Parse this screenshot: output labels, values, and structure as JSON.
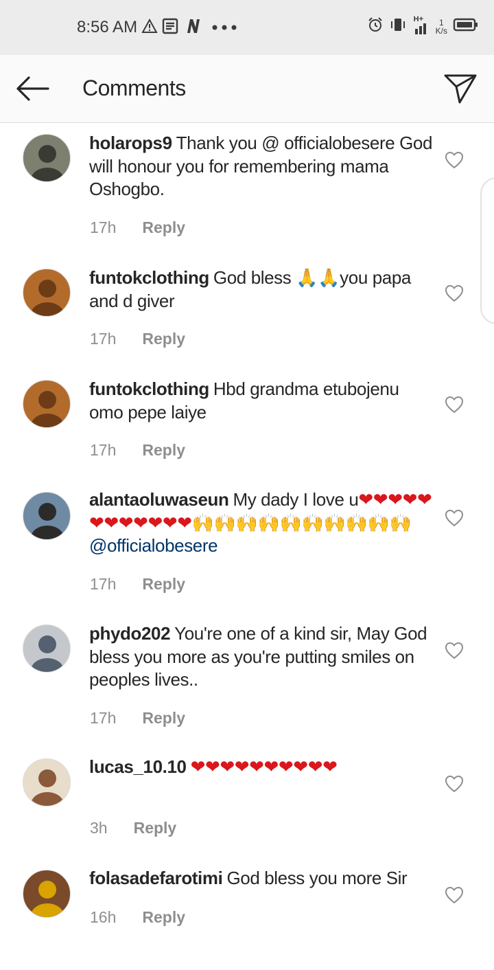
{
  "status_bar": {
    "time": "8:56 AM",
    "left_icons": [
      "warning-icon",
      "news-icon",
      "n-app-icon",
      "more-dots-icon"
    ],
    "right_icons": [
      "alarm-icon",
      "vibrate-icon",
      "signal-h-plus-icon",
      "signal-bars-icon",
      "network-speed-icon",
      "battery-icon"
    ],
    "net_speed_value": "1",
    "net_speed_unit": "K/s",
    "network_type": "H+"
  },
  "header": {
    "title": "Comments",
    "back_icon": "arrow-left-icon",
    "share_icon": "paper-plane-icon"
  },
  "comments": [
    {
      "username": "holarops9",
      "parts": [
        {
          "t": "Thank you @ officialobesere God will honour you for remembering mama Oshogbo."
        }
      ],
      "time": "17h",
      "reply": "Reply",
      "avatar": {
        "bg": "#7d7f6f",
        "fg": "#3b3a33"
      }
    },
    {
      "username": "funtokclothing",
      "parts": [
        {
          "t": "God bless "
        },
        {
          "t": "🙏🙏",
          "cls": "emoji-hands"
        },
        {
          "t": "you papa and d giver"
        }
      ],
      "time": "17h",
      "reply": "Reply",
      "avatar": {
        "bg": "#b36b2c",
        "fg": "#6d3c17"
      }
    },
    {
      "username": "funtokclothing",
      "parts": [
        {
          "t": "Hbd grandma etubojenu omo pepe laiye"
        }
      ],
      "time": "17h",
      "reply": "Reply",
      "avatar": {
        "bg": "#b36b2c",
        "fg": "#6d3c17"
      }
    },
    {
      "username": "alantaoluwaseun",
      "parts": [
        {
          "t": "My dady I love u"
        },
        {
          "t": "❤❤❤❤❤❤❤❤❤❤❤❤",
          "cls": "emoji-heart"
        },
        {
          "t": "🙌🙌🙌🙌🙌🙌🙌🙌🙌🙌",
          "cls": "emoji-hands"
        },
        {
          "t": " "
        },
        {
          "t": "@officialobesere",
          "cls": "mention"
        }
      ],
      "time": "17h",
      "reply": "Reply",
      "avatar": {
        "bg": "#6f8aa3",
        "fg": "#2b2b2b"
      }
    },
    {
      "username": "phydo202",
      "parts": [
        {
          "t": "You're one of a kind sir, May God bless you more as you're putting smiles on peoples lives.."
        }
      ],
      "time": "17h",
      "reply": "Reply",
      "avatar": {
        "bg": "#c4c8cc",
        "fg": "#556070"
      }
    },
    {
      "username": "lucas_10.10",
      "parts": [
        {
          "t": "❤❤❤❤❤❤❤❤❤❤",
          "cls": "emoji-heart"
        }
      ],
      "time": "3h",
      "reply": "Reply",
      "avatar": {
        "bg": "#e8dccb",
        "fg": "#8a5a3a"
      }
    },
    {
      "username": "folasadefarotimi",
      "parts": [
        {
          "t": "God bless you more Sir"
        }
      ],
      "time": "16h",
      "reply": "Reply",
      "avatar": {
        "bg": "#7a4a2a",
        "fg": "#d9a300"
      }
    }
  ]
}
